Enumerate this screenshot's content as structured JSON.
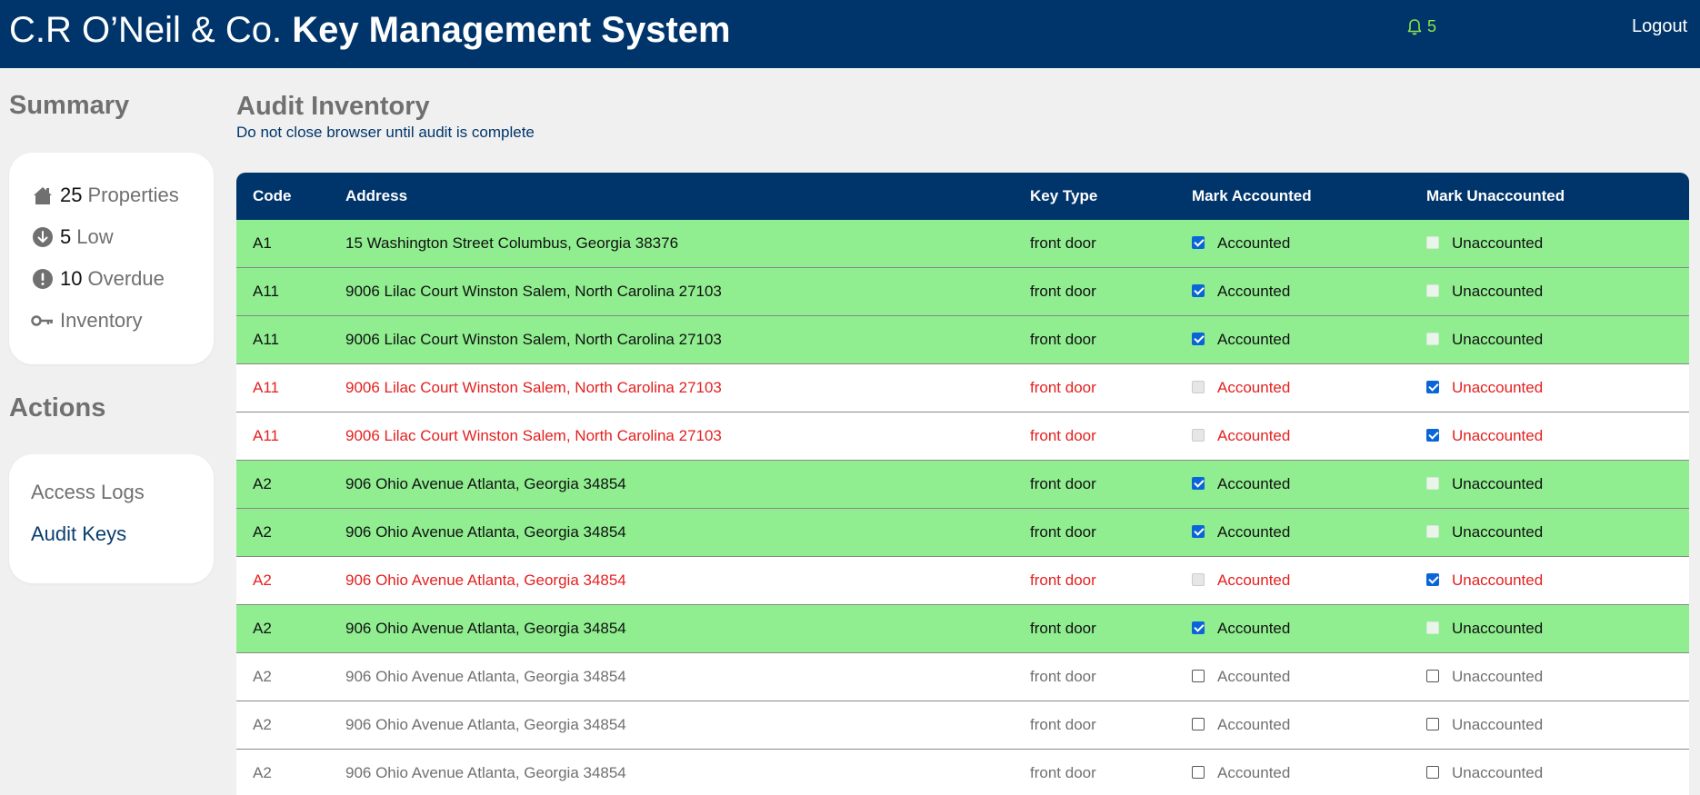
{
  "header": {
    "brand_light": "C.R O’Neil & Co.",
    "brand_bold": "Key Management System",
    "notification_count": "5",
    "logout_label": "Logout"
  },
  "sidebar": {
    "summary_title": "Summary",
    "summary": [
      {
        "icon": "house-icon",
        "count": "25",
        "label": "Properties"
      },
      {
        "icon": "arrow-down-circle-icon",
        "count": "5",
        "label": "Low"
      },
      {
        "icon": "exclamation-circle-icon",
        "count": "10",
        "label": "Overdue"
      },
      {
        "icon": "key-icon",
        "count": "",
        "label": "Inventory"
      }
    ],
    "actions_title": "Actions",
    "actions": [
      {
        "label": "Access Logs",
        "active": false
      },
      {
        "label": "Audit Keys",
        "active": true
      }
    ]
  },
  "main": {
    "title": "Audit Inventory",
    "subtitle": "Do not close browser until audit is complete"
  },
  "table": {
    "headers": [
      "Code",
      "Address",
      "Key Type",
      "Mark Accounted",
      "Mark Unaccounted"
    ],
    "accounted_label": "Accounted",
    "unaccounted_label": "Unaccounted",
    "rows": [
      {
        "code": "A1",
        "address": "15 Washington Street Columbus, Georgia 38376",
        "key_type": "front door",
        "status": "accounted"
      },
      {
        "code": "A11",
        "address": "9006 Lilac Court Winston Salem, North Carolina 27103",
        "key_type": "front door",
        "status": "accounted"
      },
      {
        "code": "A11",
        "address": "9006 Lilac Court Winston Salem, North Carolina 27103",
        "key_type": "front door",
        "status": "accounted"
      },
      {
        "code": "A11",
        "address": "9006 Lilac Court Winston Salem, North Carolina 27103",
        "key_type": "front door",
        "status": "unaccounted"
      },
      {
        "code": "A11",
        "address": "9006 Lilac Court Winston Salem, North Carolina 27103",
        "key_type": "front door",
        "status": "unaccounted"
      },
      {
        "code": "A2",
        "address": "906 Ohio Avenue Atlanta, Georgia 34854",
        "key_type": "front door",
        "status": "accounted"
      },
      {
        "code": "A2",
        "address": "906 Ohio Avenue Atlanta, Georgia 34854",
        "key_type": "front door",
        "status": "accounted"
      },
      {
        "code": "A2",
        "address": "906 Ohio Avenue Atlanta, Georgia 34854",
        "key_type": "front door",
        "status": "unaccounted"
      },
      {
        "code": "A2",
        "address": "906 Ohio Avenue Atlanta, Georgia 34854",
        "key_type": "front door",
        "status": "accounted"
      },
      {
        "code": "A2",
        "address": "906 Ohio Avenue Atlanta, Georgia 34854",
        "key_type": "front door",
        "status": "none"
      },
      {
        "code": "A2",
        "address": "906 Ohio Avenue Atlanta, Georgia 34854",
        "key_type": "front door",
        "status": "none"
      },
      {
        "code": "A2",
        "address": "906 Ohio Avenue Atlanta, Georgia 34854",
        "key_type": "front door",
        "status": "none"
      }
    ]
  },
  "colors": {
    "header_bg": "#00356b",
    "accounted_row": "#90ee90",
    "unaccounted_text": "#e52020",
    "notification": "#8ee54a"
  }
}
